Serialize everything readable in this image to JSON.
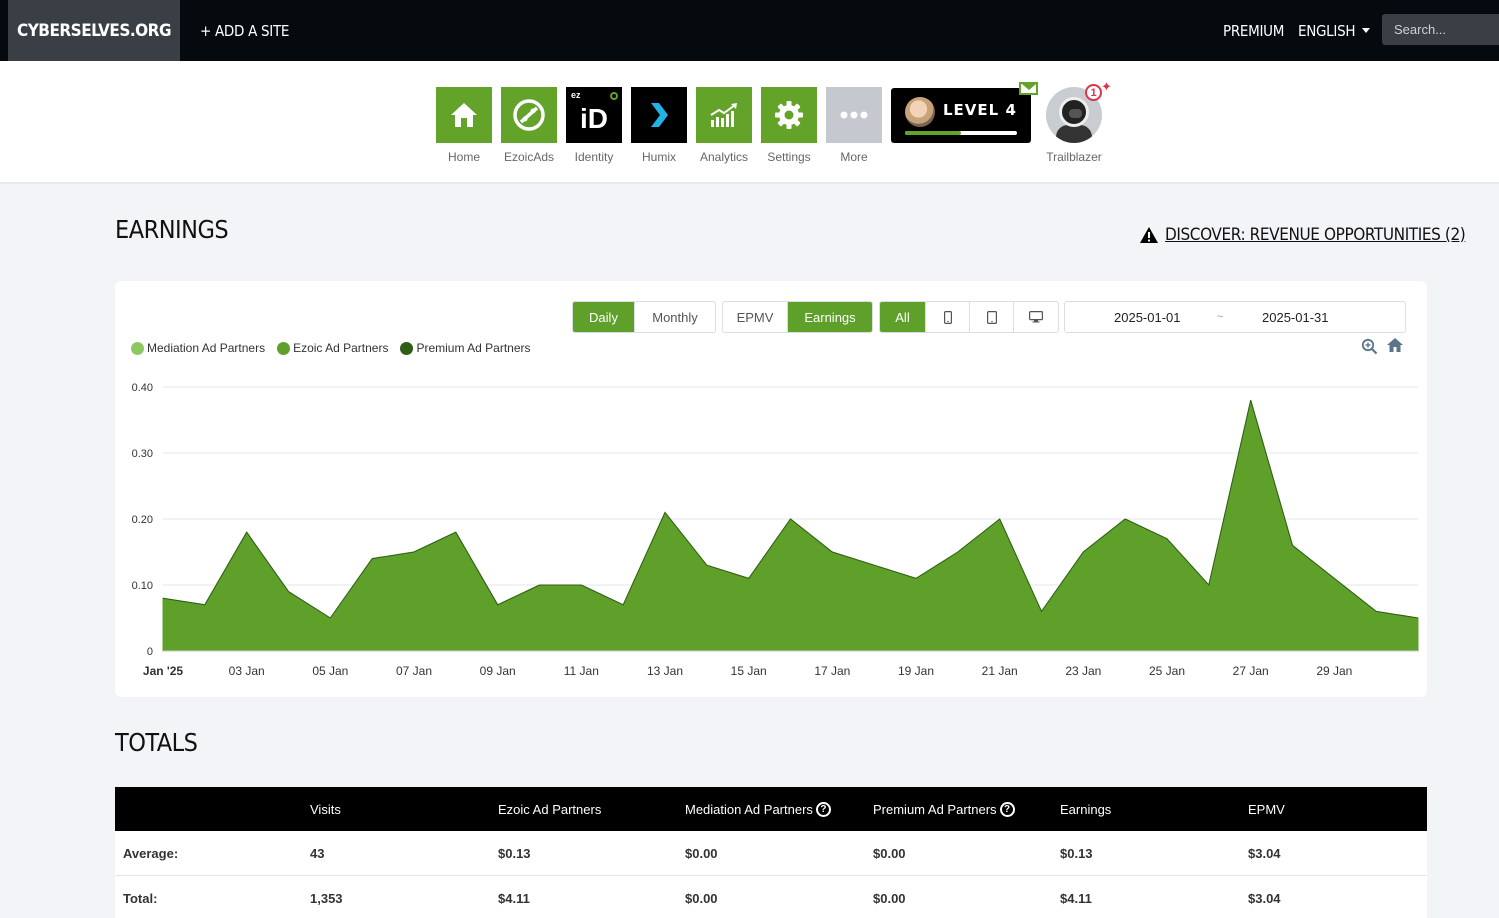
{
  "topbar": {
    "brand": "CYBERSELVES.ORG",
    "add_site": "+ ADD A SITE",
    "premium": "PREMIUM",
    "language": "ENGLISH",
    "search_placeholder": "Search..."
  },
  "apps": [
    {
      "label": "Home",
      "icon": "home-icon"
    },
    {
      "label": "EzoicAds",
      "icon": "ezoic-ads-icon"
    },
    {
      "label": "Identity",
      "icon": "identity-icon",
      "tile_text": "iD",
      "tile_superscript": "ez"
    },
    {
      "label": "Humix",
      "icon": "humix-icon"
    },
    {
      "label": "Analytics",
      "icon": "analytics-icon"
    },
    {
      "label": "Settings",
      "icon": "gear-icon"
    },
    {
      "label": "More",
      "icon": "more-dots-icon"
    }
  ],
  "level": {
    "label": "LEVEL 4",
    "progress": 0.5
  },
  "trailblazer": {
    "label": "Trailblazer",
    "notification_count": "1"
  },
  "earnings": {
    "title": "EARNINGS",
    "discover_link": "DISCOVER: REVENUE OPPORTUNITIES (2)"
  },
  "controls": {
    "period": [
      {
        "label": "Daily",
        "active": true
      },
      {
        "label": "Monthly",
        "active": false
      }
    ],
    "metric": [
      {
        "label": "EPMV",
        "active": false
      },
      {
        "label": "Earnings",
        "active": true
      }
    ],
    "device": [
      {
        "label": "All",
        "active": true
      }
    ],
    "start_date": "2025-01-01",
    "date_separator": "~",
    "end_date": "2025-01-31"
  },
  "legend": [
    {
      "name": "Mediation Ad Partners",
      "color": "#8fc860"
    },
    {
      "name": "Ezoic Ad Partners",
      "color": "#5fa02a"
    },
    {
      "name": "Premium Ad Partners",
      "color": "#2f5e16"
    }
  ],
  "chart_data": {
    "type": "area",
    "x": [
      "2025-01-01",
      "2025-01-02",
      "2025-01-03",
      "2025-01-04",
      "2025-01-05",
      "2025-01-06",
      "2025-01-07",
      "2025-01-08",
      "2025-01-09",
      "2025-01-10",
      "2025-01-11",
      "2025-01-12",
      "2025-01-13",
      "2025-01-14",
      "2025-01-15",
      "2025-01-16",
      "2025-01-17",
      "2025-01-18",
      "2025-01-19",
      "2025-01-20",
      "2025-01-21",
      "2025-01-22",
      "2025-01-23",
      "2025-01-24",
      "2025-01-25",
      "2025-01-26",
      "2025-01-27",
      "2025-01-28",
      "2025-01-29",
      "2025-01-30",
      "2025-01-31"
    ],
    "x_tick_labels": [
      "Jan '25",
      "03 Jan",
      "05 Jan",
      "07 Jan",
      "09 Jan",
      "11 Jan",
      "13 Jan",
      "15 Jan",
      "17 Jan",
      "19 Jan",
      "21 Jan",
      "23 Jan",
      "25 Jan",
      "27 Jan",
      "29 Jan"
    ],
    "y_ticks": [
      "0",
      "0.10",
      "0.20",
      "0.30",
      "0.40"
    ],
    "ylim": [
      0,
      0.4
    ],
    "series": [
      {
        "name": "Mediation Ad Partners",
        "values": [
          0,
          0,
          0,
          0,
          0,
          0,
          0,
          0,
          0,
          0,
          0,
          0,
          0,
          0,
          0,
          0,
          0,
          0,
          0,
          0,
          0,
          0,
          0,
          0,
          0,
          0,
          0,
          0,
          0,
          0,
          0
        ]
      },
      {
        "name": "Ezoic Ad Partners",
        "values": [
          0.08,
          0.07,
          0.18,
          0.09,
          0.05,
          0.14,
          0.15,
          0.18,
          0.07,
          0.1,
          0.1,
          0.07,
          0.21,
          0.13,
          0.11,
          0.2,
          0.15,
          0.13,
          0.11,
          0.15,
          0.2,
          0.06,
          0.15,
          0.2,
          0.17,
          0.1,
          0.38,
          0.16,
          0.11,
          0.06,
          0.05
        ]
      },
      {
        "name": "Premium Ad Partners",
        "values": [
          0,
          0,
          0,
          0,
          0,
          0,
          0,
          0,
          0,
          0,
          0,
          0,
          0,
          0,
          0,
          0,
          0,
          0,
          0,
          0,
          0,
          0,
          0,
          0,
          0,
          0,
          0,
          0,
          0,
          0,
          0
        ]
      }
    ],
    "grid": true,
    "legend_position": "top-left"
  },
  "totals": {
    "title": "TOTALS",
    "columns": [
      "",
      "Visits",
      "Ezoic Ad Partners",
      "Mediation Ad Partners",
      "Premium Ad Partners",
      "Earnings",
      "EPMV"
    ],
    "rows": [
      [
        "Average:",
        "43",
        "$0.13",
        "$0.00",
        "$0.00",
        "$0.13",
        "$3.04"
      ],
      [
        "Total:",
        "1,353",
        "$4.11",
        "$0.00",
        "$0.00",
        "$4.11",
        "$3.04"
      ]
    ]
  }
}
